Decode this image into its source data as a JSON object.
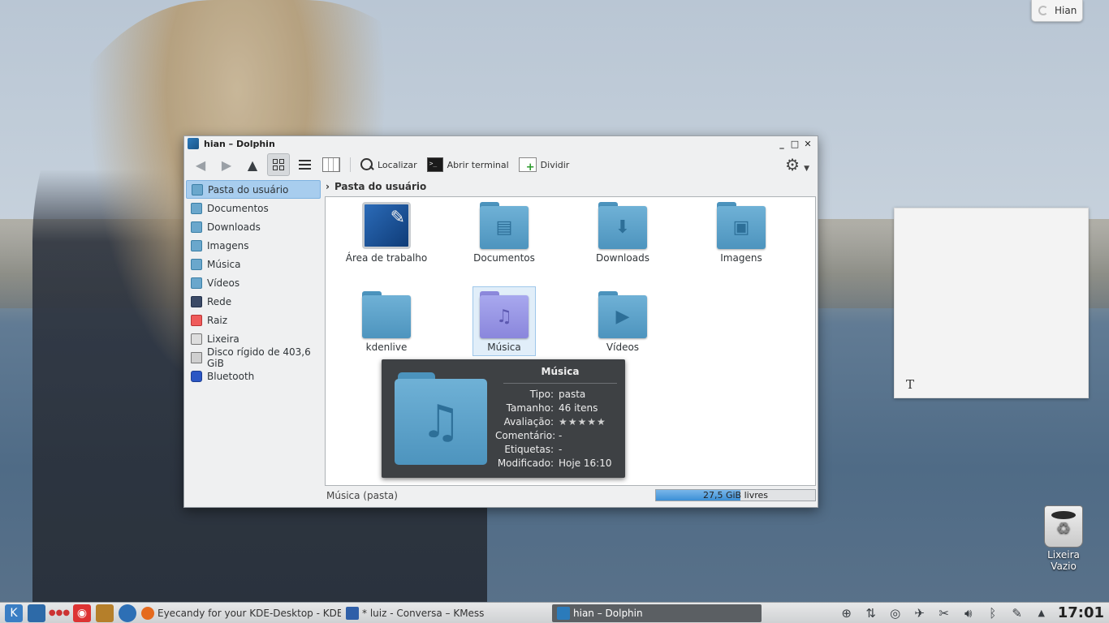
{
  "user_badge": {
    "name": "Hian"
  },
  "window": {
    "title": "hian – Dolphin",
    "buttons": {
      "minimize": "_",
      "maximize": "□",
      "close": "✕"
    }
  },
  "toolbar": {
    "localizar": "Localizar",
    "abrir_terminal": "Abrir terminal",
    "dividir": "Dividir"
  },
  "sidebar": {
    "items": [
      {
        "label": "Pasta do usuário",
        "icon": "home-icon"
      },
      {
        "label": "Documentos",
        "icon": "folder-icon"
      },
      {
        "label": "Downloads",
        "icon": "folder-icon"
      },
      {
        "label": "Imagens",
        "icon": "folder-icon"
      },
      {
        "label": "Música",
        "icon": "folder-icon"
      },
      {
        "label": "Vídeos",
        "icon": "folder-icon"
      },
      {
        "label": "Rede",
        "icon": "network-icon"
      },
      {
        "label": "Raiz",
        "icon": "root-icon"
      },
      {
        "label": "Lixeira",
        "icon": "trash-icon"
      },
      {
        "label": "Disco rígido de 403,6 GiB",
        "icon": "disk-icon"
      },
      {
        "label": "Bluetooth",
        "icon": "bluetooth-icon"
      }
    ]
  },
  "breadcrumb": {
    "arrow": "›",
    "current": "Pasta do usuário"
  },
  "files": [
    {
      "label": "Área de trabalho"
    },
    {
      "label": "Documentos"
    },
    {
      "label": "Downloads"
    },
    {
      "label": "Imagens"
    },
    {
      "label": "kdenlive"
    },
    {
      "label": "Música"
    },
    {
      "label": "Vídeos"
    }
  ],
  "tooltip": {
    "title": "Música",
    "rows": [
      {
        "k": "Tipo:",
        "v": "pasta"
      },
      {
        "k": "Tamanho:",
        "v": "46 itens"
      },
      {
        "k": "Avaliação:",
        "v": "★★★★★"
      },
      {
        "k": "Comentário:",
        "v": "-"
      },
      {
        "k": "Etiquetas:",
        "v": "-"
      },
      {
        "k": "Modificado:",
        "v": "Hoje 16:10"
      }
    ]
  },
  "statusbar": {
    "text": "Música (pasta)",
    "space_text": "27,5 GiB livres",
    "used_fraction": 0.53
  },
  "desktop_trash": {
    "line1": "Lixeira",
    "line2": "Vazio"
  },
  "taskbar": {
    "tasks": [
      {
        "label": "Eyecandy for your KDE-Desktop - KDE-Look"
      },
      {
        "label": "* luiz - Conversa – KMess"
      },
      {
        "label": "hian – Dolphin"
      }
    ],
    "clock": "17:01"
  },
  "colors": {
    "accent": "#a8cdee",
    "folder": "#5ca3cb",
    "selected_folder": "#9a96e6",
    "tooltip_bg": "#3e4144"
  }
}
